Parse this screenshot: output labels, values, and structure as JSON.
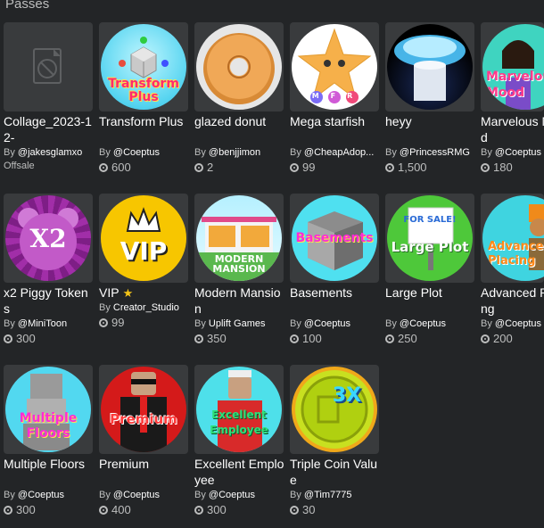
{
  "section": {
    "title": "Passes"
  },
  "passes": [
    {
      "name": "Collage_2023-12-",
      "by": "By",
      "creator": "@jakesglamxo",
      "price": "",
      "offsale": "Offsale",
      "thumb_text": ""
    },
    {
      "name": "Transform Plus",
      "by": "By",
      "creator": "@Coeptus",
      "price": "600",
      "thumb_text": "Transform Plus"
    },
    {
      "name": "glazed donut",
      "by": "By",
      "creator": "@benjjimon",
      "price": "2",
      "thumb_text": ""
    },
    {
      "name": "Mega starfish",
      "by": "By",
      "creator": "@CheapAdop...",
      "price": "99",
      "thumb_text": "MFR"
    },
    {
      "name": "heyy",
      "by": "By",
      "creator": "@PrincessRMG",
      "price": "1,500",
      "thumb_text": ""
    },
    {
      "name": "Marvelous Mood",
      "by": "By",
      "creator": "@Coeptus",
      "price": "180",
      "thumb_text": "Marvelous Mood"
    },
    {
      "name": "x2 Piggy Tokens",
      "by": "By",
      "creator": "@MiniToon",
      "price": "300",
      "thumb_text": "X2"
    },
    {
      "name": "VIP",
      "by": "By",
      "creator": "Creator_Studio",
      "price": "99",
      "thumb_text": "VIP",
      "star": "★"
    },
    {
      "name": "Modern Mansion",
      "by": "By",
      "creator": "Uplift Games",
      "price": "350",
      "thumb_text": "MODERN MANSION"
    },
    {
      "name": "Basements",
      "by": "By",
      "creator": "@Coeptus",
      "price": "100",
      "thumb_text": "Basements"
    },
    {
      "name": "Large Plot",
      "by": "By",
      "creator": "@Coeptus",
      "price": "250",
      "thumb_text": "Large Plot",
      "sign_text": "FOR SALE!"
    },
    {
      "name": "Advanced Placing",
      "by": "By",
      "creator": "@Coeptus",
      "price": "200",
      "thumb_text": "Advanced Placing"
    },
    {
      "name": "Multiple Floors",
      "by": "By",
      "creator": "@Coeptus",
      "price": "300",
      "thumb_text": "Multiple Floors"
    },
    {
      "name": "Premium",
      "by": "By",
      "creator": "@Coeptus",
      "price": "400",
      "thumb_text": "Premium"
    },
    {
      "name": "Excellent Employee",
      "by": "By",
      "creator": "@Coeptus",
      "price": "300",
      "thumb_text": "Excellent Employee"
    },
    {
      "name": "Triple Coin Value",
      "by": "By",
      "creator": "@Tim7775",
      "price": "30",
      "thumb_text": "3X"
    }
  ],
  "colors": {
    "background": "#232527",
    "card": "#393b3d",
    "muted_text": "#bdbebe",
    "star": "#f5c518"
  }
}
